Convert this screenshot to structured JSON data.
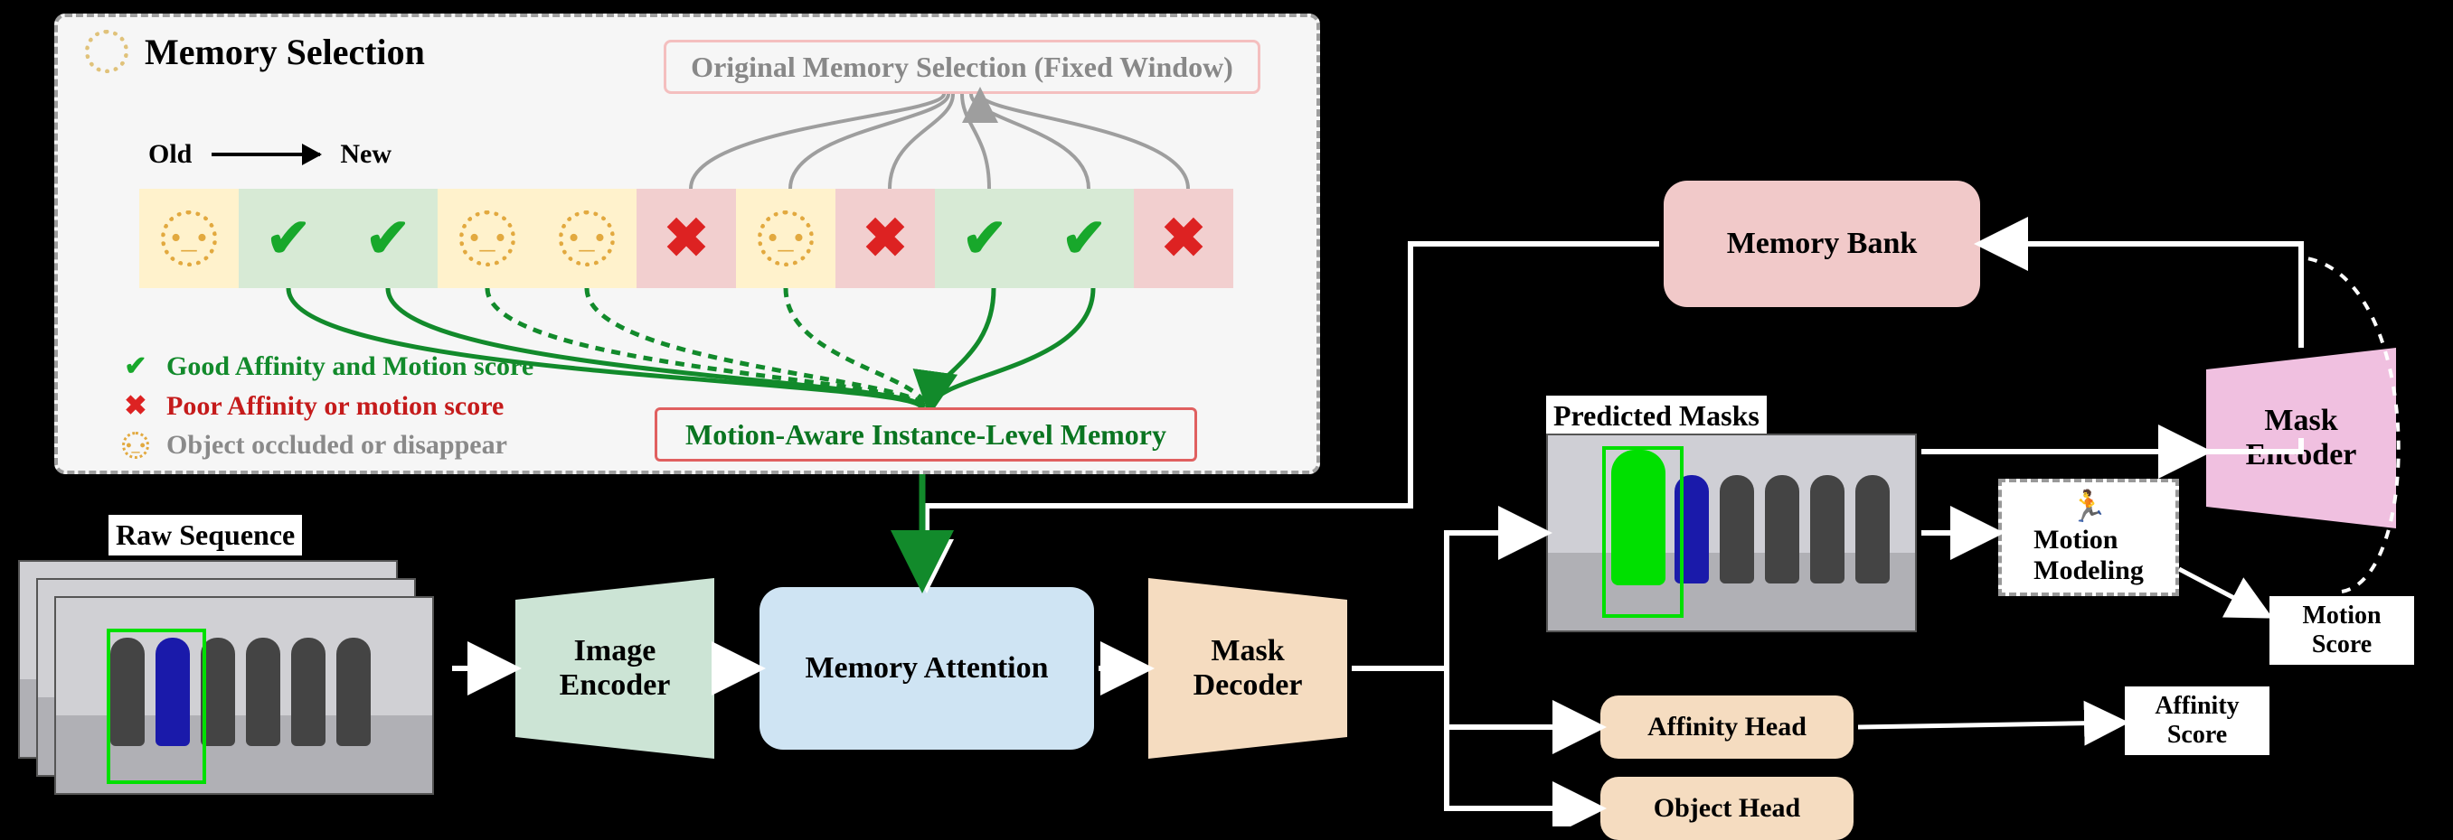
{
  "mem_sel": {
    "title": "Memory Selection",
    "original_box": "Original Memory Selection (Fixed Window)",
    "old_label": "Old",
    "new_label": "New",
    "motion_aware_box": "Motion-Aware Instance-Level Memory",
    "frames": [
      "occl",
      "good",
      "good",
      "occl",
      "occl",
      "bad",
      "occl",
      "bad",
      "good",
      "good",
      "bad"
    ],
    "legend": {
      "good": "Good Affinity and Motion score",
      "bad": "Poor Affinity or motion score",
      "occluded": "Object occluded or disappear"
    }
  },
  "pipeline": {
    "raw_sequence_label": "Raw Sequence",
    "image_encoder": "Image\nEncoder",
    "memory_attention": "Memory Attention",
    "mask_decoder": "Mask\nDecoder",
    "memory_bank": "Memory Bank",
    "mask_encoder": "Mask\nEncoder",
    "predicted_masks_label": "Predicted Masks",
    "affinity_head": "Affinity Head",
    "object_head": "Object Head",
    "motion_modeling": "Motion\nModeling",
    "motion_score": "Motion\nScore",
    "affinity_score": "Affinity\nScore"
  },
  "colors": {
    "good_bg": "#d7ead5",
    "bad_bg": "#f2cfcf",
    "occl_bg": "#fff2cc",
    "green": "#128a2b",
    "red": "#c51b1b",
    "gray": "#8a8a8a"
  }
}
